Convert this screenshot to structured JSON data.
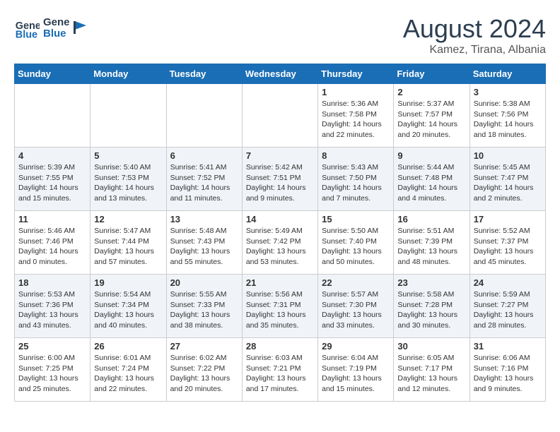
{
  "header": {
    "logo_general": "General",
    "logo_blue": "Blue",
    "main_title": "August 2024",
    "subtitle": "Kamez, Tirana, Albania"
  },
  "days_of_week": [
    "Sunday",
    "Monday",
    "Tuesday",
    "Wednesday",
    "Thursday",
    "Friday",
    "Saturday"
  ],
  "weeks": [
    [
      {
        "day": "",
        "content": ""
      },
      {
        "day": "",
        "content": ""
      },
      {
        "day": "",
        "content": ""
      },
      {
        "day": "",
        "content": ""
      },
      {
        "day": "1",
        "content": "Sunrise: 5:36 AM\nSunset: 7:58 PM\nDaylight: 14 hours\nand 22 minutes."
      },
      {
        "day": "2",
        "content": "Sunrise: 5:37 AM\nSunset: 7:57 PM\nDaylight: 14 hours\nand 20 minutes."
      },
      {
        "day": "3",
        "content": "Sunrise: 5:38 AM\nSunset: 7:56 PM\nDaylight: 14 hours\nand 18 minutes."
      }
    ],
    [
      {
        "day": "4",
        "content": "Sunrise: 5:39 AM\nSunset: 7:55 PM\nDaylight: 14 hours\nand 15 minutes."
      },
      {
        "day": "5",
        "content": "Sunrise: 5:40 AM\nSunset: 7:53 PM\nDaylight: 14 hours\nand 13 minutes."
      },
      {
        "day": "6",
        "content": "Sunrise: 5:41 AM\nSunset: 7:52 PM\nDaylight: 14 hours\nand 11 minutes."
      },
      {
        "day": "7",
        "content": "Sunrise: 5:42 AM\nSunset: 7:51 PM\nDaylight: 14 hours\nand 9 minutes."
      },
      {
        "day": "8",
        "content": "Sunrise: 5:43 AM\nSunset: 7:50 PM\nDaylight: 14 hours\nand 7 minutes."
      },
      {
        "day": "9",
        "content": "Sunrise: 5:44 AM\nSunset: 7:48 PM\nDaylight: 14 hours\nand 4 minutes."
      },
      {
        "day": "10",
        "content": "Sunrise: 5:45 AM\nSunset: 7:47 PM\nDaylight: 14 hours\nand 2 minutes."
      }
    ],
    [
      {
        "day": "11",
        "content": "Sunrise: 5:46 AM\nSunset: 7:46 PM\nDaylight: 14 hours\nand 0 minutes."
      },
      {
        "day": "12",
        "content": "Sunrise: 5:47 AM\nSunset: 7:44 PM\nDaylight: 13 hours\nand 57 minutes."
      },
      {
        "day": "13",
        "content": "Sunrise: 5:48 AM\nSunset: 7:43 PM\nDaylight: 13 hours\nand 55 minutes."
      },
      {
        "day": "14",
        "content": "Sunrise: 5:49 AM\nSunset: 7:42 PM\nDaylight: 13 hours\nand 53 minutes."
      },
      {
        "day": "15",
        "content": "Sunrise: 5:50 AM\nSunset: 7:40 PM\nDaylight: 13 hours\nand 50 minutes."
      },
      {
        "day": "16",
        "content": "Sunrise: 5:51 AM\nSunset: 7:39 PM\nDaylight: 13 hours\nand 48 minutes."
      },
      {
        "day": "17",
        "content": "Sunrise: 5:52 AM\nSunset: 7:37 PM\nDaylight: 13 hours\nand 45 minutes."
      }
    ],
    [
      {
        "day": "18",
        "content": "Sunrise: 5:53 AM\nSunset: 7:36 PM\nDaylight: 13 hours\nand 43 minutes."
      },
      {
        "day": "19",
        "content": "Sunrise: 5:54 AM\nSunset: 7:34 PM\nDaylight: 13 hours\nand 40 minutes."
      },
      {
        "day": "20",
        "content": "Sunrise: 5:55 AM\nSunset: 7:33 PM\nDaylight: 13 hours\nand 38 minutes."
      },
      {
        "day": "21",
        "content": "Sunrise: 5:56 AM\nSunset: 7:31 PM\nDaylight: 13 hours\nand 35 minutes."
      },
      {
        "day": "22",
        "content": "Sunrise: 5:57 AM\nSunset: 7:30 PM\nDaylight: 13 hours\nand 33 minutes."
      },
      {
        "day": "23",
        "content": "Sunrise: 5:58 AM\nSunset: 7:28 PM\nDaylight: 13 hours\nand 30 minutes."
      },
      {
        "day": "24",
        "content": "Sunrise: 5:59 AM\nSunset: 7:27 PM\nDaylight: 13 hours\nand 28 minutes."
      }
    ],
    [
      {
        "day": "25",
        "content": "Sunrise: 6:00 AM\nSunset: 7:25 PM\nDaylight: 13 hours\nand 25 minutes."
      },
      {
        "day": "26",
        "content": "Sunrise: 6:01 AM\nSunset: 7:24 PM\nDaylight: 13 hours\nand 22 minutes."
      },
      {
        "day": "27",
        "content": "Sunrise: 6:02 AM\nSunset: 7:22 PM\nDaylight: 13 hours\nand 20 minutes."
      },
      {
        "day": "28",
        "content": "Sunrise: 6:03 AM\nSunset: 7:21 PM\nDaylight: 13 hours\nand 17 minutes."
      },
      {
        "day": "29",
        "content": "Sunrise: 6:04 AM\nSunset: 7:19 PM\nDaylight: 13 hours\nand 15 minutes."
      },
      {
        "day": "30",
        "content": "Sunrise: 6:05 AM\nSunset: 7:17 PM\nDaylight: 13 hours\nand 12 minutes."
      },
      {
        "day": "31",
        "content": "Sunrise: 6:06 AM\nSunset: 7:16 PM\nDaylight: 13 hours\nand 9 minutes."
      }
    ]
  ]
}
